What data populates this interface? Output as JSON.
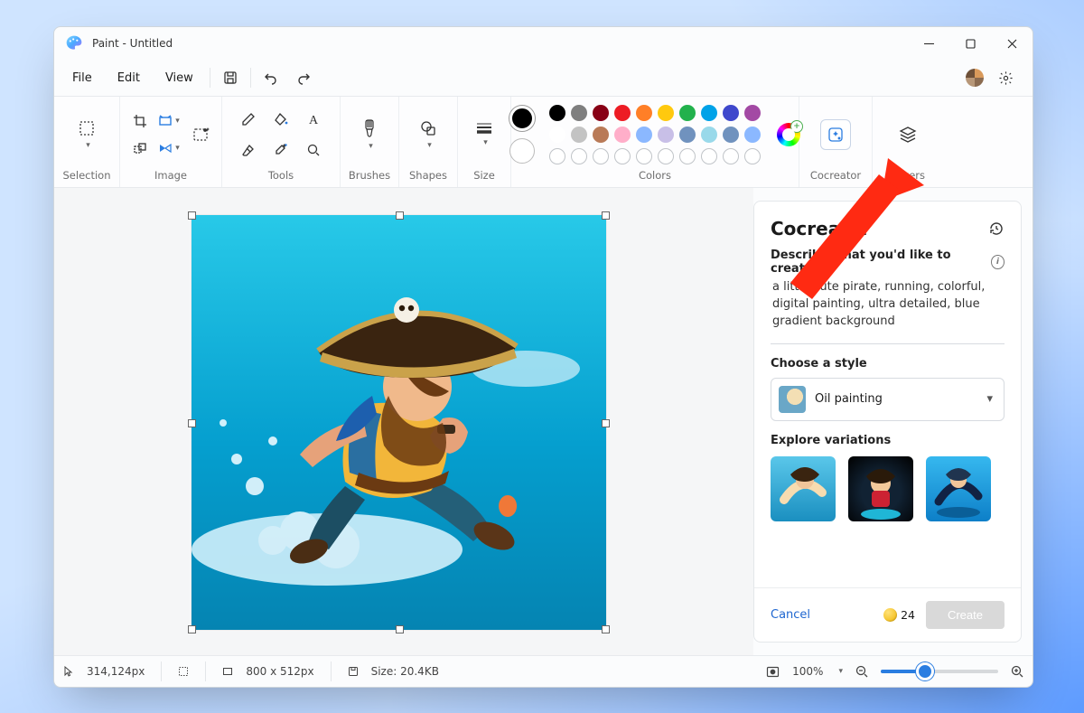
{
  "window": {
    "title": "Paint - Untitled"
  },
  "menubar": {
    "file": "File",
    "edit": "Edit",
    "view": "View"
  },
  "ribbon": {
    "groups": {
      "selection": "Selection",
      "image": "Image",
      "tools": "Tools",
      "brushes": "Brushes",
      "shapes": "Shapes",
      "size": "Size",
      "colors": "Colors",
      "cocreator": "Cocreator",
      "layers": "Layers"
    },
    "color_row1": [
      "#000000",
      "#7f7f7f",
      "#880015",
      "#ed1c24",
      "#ff7f27",
      "#ffc90e",
      "#22b14c",
      "#00a2e8",
      "#3f48cc",
      "#a349a4"
    ],
    "color_row2": [
      "#ffffff",
      "#c3c3c3",
      "#b97a57",
      "#ffaec9",
      "#8bb8ff",
      "#c8bfe7",
      "#7092be",
      "#99d9ea",
      "#7092be",
      "#8bb8ff"
    ]
  },
  "cocreator": {
    "title": "Cocreator",
    "describe_label": "Describe what you'd like to create",
    "prompt": "a little cute pirate, running, colorful, digital painting, ultra detailed, blue gradient background",
    "style_label": "Choose a style",
    "style_value": "Oil painting",
    "explore_label": "Explore variations",
    "cancel": "Cancel",
    "credits": "24",
    "create": "Create"
  },
  "status": {
    "cursor_pos": "314,124px",
    "canvas_dims": "800  x  512px",
    "file_size": "Size: 20.4KB",
    "zoom": "100%"
  }
}
